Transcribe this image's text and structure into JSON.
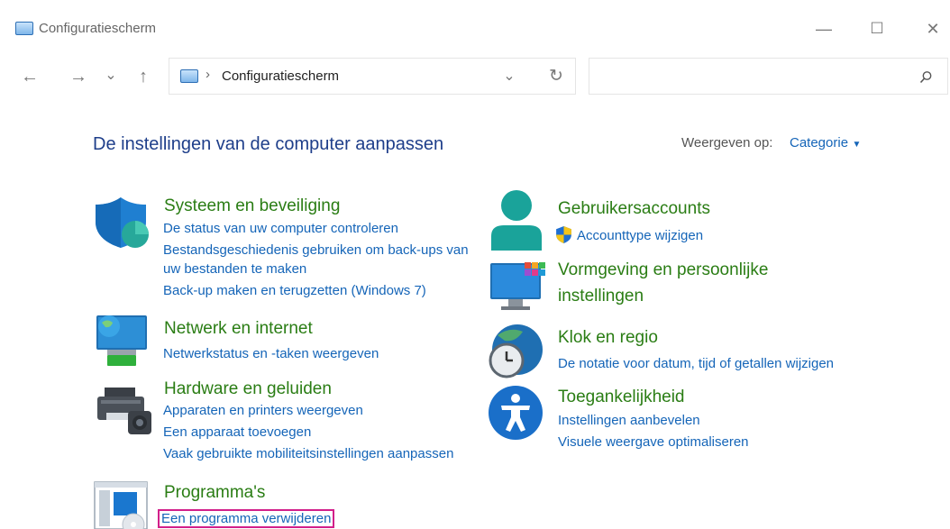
{
  "window": {
    "title": "Configuratiescherm",
    "controls": {
      "minimize": "—",
      "maximize": "☐",
      "close": "✕"
    }
  },
  "nav": {
    "back": "←",
    "forward": "→",
    "recent": "⌄",
    "up": "↑",
    "breadcrumb_separator": "›",
    "breadcrumb": "Configuratiescherm",
    "dropdown": "⌄",
    "refresh": "↻",
    "search_placeholder": ""
  },
  "main": {
    "heading": "De instellingen van de computer aanpassen",
    "view_by_label": "Weergeven op:",
    "view_by_value": "Categorie"
  },
  "categories_left": [
    {
      "title": "Systeem en beveiliging",
      "icon": "shield-icon",
      "links": [
        "De status van uw computer controleren",
        "Bestandsgeschiedenis gebruiken om back-ups van",
        "uw bestanden te maken",
        "Back-up maken en terugzetten (Windows 7)"
      ]
    },
    {
      "title": "Netwerk en internet",
      "icon": "network-icon",
      "links": [
        "Netwerkstatus en -taken weergeven"
      ]
    },
    {
      "title": "Hardware en geluiden",
      "icon": "printer-icon",
      "links": [
        "Apparaten en printers weergeven",
        "Een apparaat toevoegen",
        "Vaak gebruikte mobiliteitsinstellingen aanpassen"
      ]
    },
    {
      "title": "Programma's",
      "icon": "programs-icon",
      "links": [
        "Een programma verwijderen"
      ]
    }
  ],
  "categories_right": [
    {
      "title": "Gebruikersaccounts",
      "icon": "user-icon",
      "links": [
        "Accounttype wijzigen"
      ]
    },
    {
      "title_line1": "Vormgeving en persoonlijke",
      "title_line2": "instellingen",
      "icon": "monitor-icon",
      "links": []
    },
    {
      "title": "Klok en regio",
      "icon": "clock-globe-icon",
      "links": [
        "De notatie voor datum, tijd of getallen wijzigen"
      ]
    },
    {
      "title": "Toegankelijkheid",
      "icon": "accessibility-icon",
      "links": [
        "Instellingen aanbevelen",
        "Visuele weergave optimaliseren"
      ]
    }
  ],
  "colors": {
    "category_title": "#2a7d14",
    "link": "#1565b8",
    "heading": "#1e3e8a",
    "highlight_box": "#d21f8a"
  }
}
